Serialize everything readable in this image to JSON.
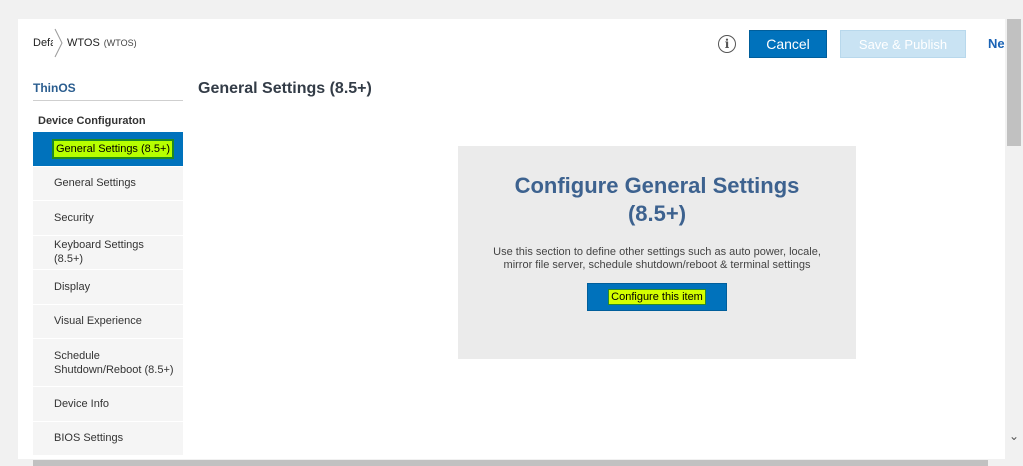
{
  "breadcrumb": {
    "first": "Default",
    "current": "WTOS",
    "current_sub": "(WTOS)"
  },
  "toolbar": {
    "info_icon": "i",
    "cancel_label": "Cancel",
    "publish_label": "Save & Publish",
    "next_label": "Next"
  },
  "sidebar": {
    "title": "ThinOS",
    "section_label": "Device Configuraton",
    "items": [
      {
        "label": "General Settings (8.5+)"
      },
      {
        "label": "General Settings"
      },
      {
        "label": "Security"
      },
      {
        "label": "Keyboard Settings (8.5+)"
      },
      {
        "label": "Display"
      },
      {
        "label": "Visual Experience"
      },
      {
        "label": "Schedule Shutdown/Reboot (8.5+)"
      },
      {
        "label": "Device Info"
      },
      {
        "label": "BIOS Settings"
      }
    ]
  },
  "main": {
    "title": "General Settings (8.5+)",
    "panel": {
      "heading": "Configure General Settings (8.5+)",
      "description": "Use this section to define other settings such as auto power, locale, mirror file server, schedule shutdown/reboot & terminal settings",
      "button_label": "Configure this item"
    }
  },
  "colors": {
    "primary": "#0072bc",
    "disabled": "#c9e3f3",
    "heading": "#3d628f",
    "highlight": "#b7ff00"
  }
}
